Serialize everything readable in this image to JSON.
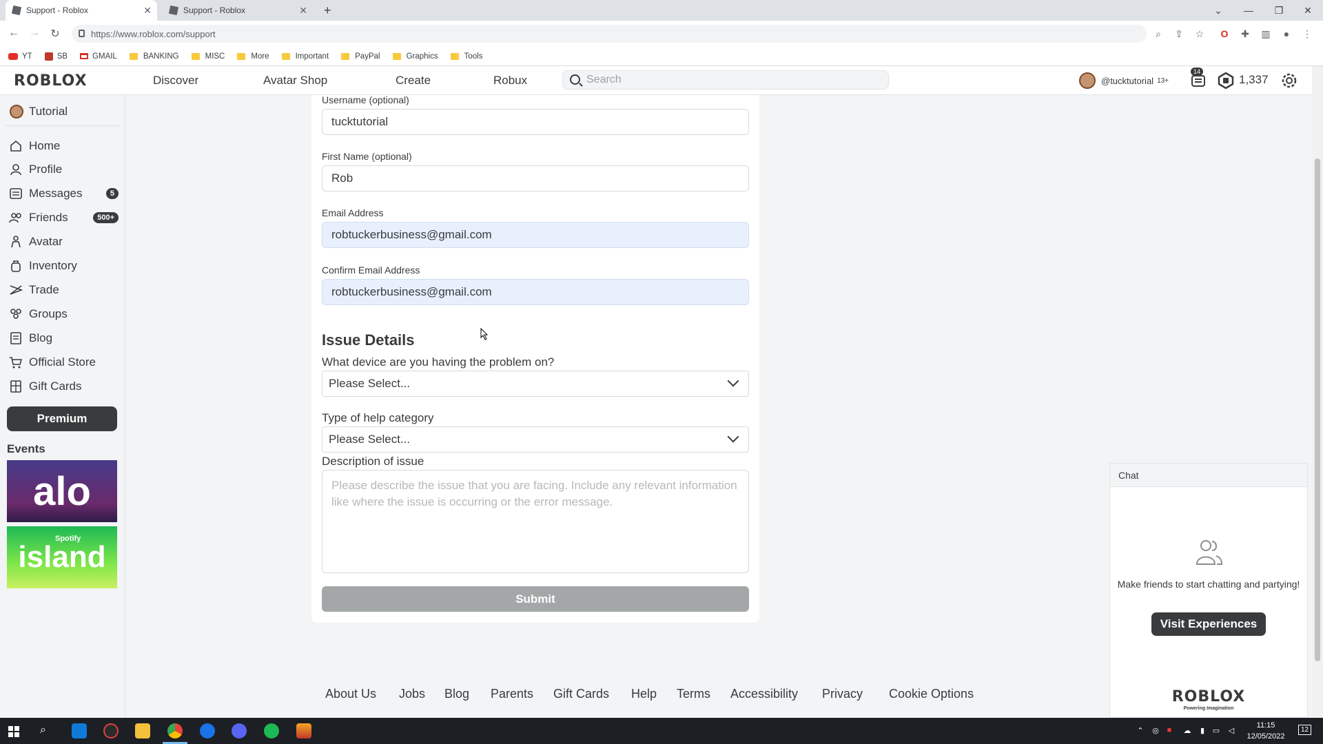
{
  "browser": {
    "tabs": [
      {
        "title": "Support - Roblox",
        "active": true
      },
      {
        "title": "Support - Roblox",
        "active": false
      }
    ],
    "url": "https://www.roblox.com/support",
    "bookmarks": [
      "YT",
      "SB",
      "GMAIL",
      "BANKING",
      "MISC",
      "More",
      "Important",
      "PayPal",
      "Graphics",
      "Tools"
    ]
  },
  "header": {
    "logo": "ROBLOX",
    "nav": [
      "Discover",
      "Avatar Shop",
      "Create",
      "Robux"
    ],
    "search_placeholder": "Search",
    "username": "@tucktutorial",
    "age_tag": "13+",
    "notification_count": "14",
    "robux": "1,337"
  },
  "sidebar": {
    "user": "Tutorial",
    "items": [
      {
        "label": "Home",
        "icon": "home-icon"
      },
      {
        "label": "Profile",
        "icon": "profile-icon"
      },
      {
        "label": "Messages",
        "icon": "messages-icon",
        "badge": "5"
      },
      {
        "label": "Friends",
        "icon": "friends-icon",
        "badge": "500+"
      },
      {
        "label": "Avatar",
        "icon": "avatar-icon"
      },
      {
        "label": "Inventory",
        "icon": "inventory-icon"
      },
      {
        "label": "Trade",
        "icon": "trade-icon"
      },
      {
        "label": "Groups",
        "icon": "groups-icon"
      },
      {
        "label": "Blog",
        "icon": "blog-icon"
      },
      {
        "label": "Official Store",
        "icon": "store-icon"
      },
      {
        "label": "Gift Cards",
        "icon": "gift-card-icon"
      }
    ],
    "premium": "Premium",
    "events_label": "Events",
    "events": [
      {
        "name": "alo"
      },
      {
        "name": "island",
        "sub": "Spotify"
      }
    ]
  },
  "form": {
    "username_label": "Username (optional)",
    "username_value": "tucktutorial",
    "firstname_label": "First Name (optional)",
    "firstname_value": "Rob",
    "email_label": "Email Address",
    "email_value": "robtuckerbusiness@gmail.com",
    "confirm_email_label": "Confirm Email Address",
    "confirm_email_value": "robtuckerbusiness@gmail.com",
    "issue_heading": "Issue Details",
    "device_question": "What device are you having the problem on?",
    "device_value": "Please Select...",
    "category_question": "Type of help category",
    "category_value": "Please Select...",
    "description_label": "Description of issue",
    "description_placeholder": "Please describe the issue that you are facing. Include any relevant information like where the issue is occurring or the error message.",
    "submit": "Submit"
  },
  "footer": {
    "links": [
      "About Us",
      "Jobs",
      "Blog",
      "Parents",
      "Gift Cards",
      "Help",
      "Terms",
      "Accessibility",
      "Privacy",
      "Cookie Options"
    ]
  },
  "chat": {
    "title": "Chat",
    "message": "Make friends to start chatting and partying!",
    "button": "Visit Experiences",
    "logo": "ROBLOX",
    "tagline": "Powering Imagination"
  },
  "taskbar": {
    "time": "11:15",
    "date": "12/05/2022",
    "notifications": "12"
  }
}
